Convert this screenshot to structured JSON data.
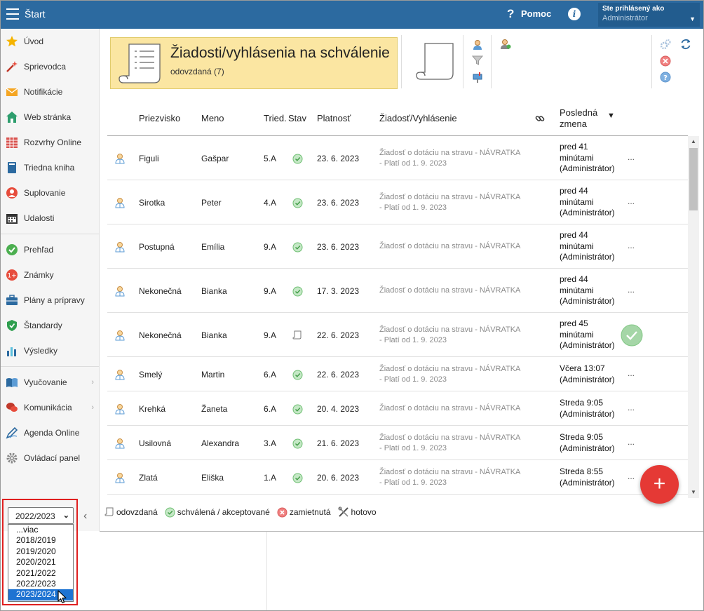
{
  "topbar": {
    "app_title": "Štart",
    "help_label": "Pomoc",
    "info_glyph": "i",
    "user_line1": "Ste prihlásený ako",
    "user_line2": "Administrátor"
  },
  "sidebar": {
    "group1": [
      {
        "label": "Úvod",
        "icon": "star-icon"
      },
      {
        "label": "Sprievodca",
        "icon": "magic-wand-icon"
      },
      {
        "label": "Notifikácie",
        "icon": "envelope-icon"
      },
      {
        "label": "Web stránka",
        "icon": "home-icon"
      },
      {
        "label": "Rozvrhy Online",
        "icon": "timetable-icon"
      },
      {
        "label": "Triedna kniha",
        "icon": "book-icon"
      },
      {
        "label": "Suplovanie",
        "icon": "substitute-icon"
      },
      {
        "label": "Udalosti",
        "icon": "calendar-icon"
      }
    ],
    "group2": [
      {
        "label": "Prehľad",
        "icon": "check-circle-icon"
      },
      {
        "label": "Známky",
        "icon": "grades-icon"
      },
      {
        "label": "Plány a prípravy",
        "icon": "briefcase-icon"
      },
      {
        "label": "Štandardy",
        "icon": "shield-icon"
      },
      {
        "label": "Výsledky",
        "icon": "bar-chart-icon"
      }
    ],
    "group3": [
      {
        "label": "Vyučovanie",
        "icon": "open-book-icon",
        "chevron": "›"
      },
      {
        "label": "Komunikácia",
        "icon": "chat-icon",
        "chevron": "›"
      },
      {
        "label": "Agenda Online",
        "icon": "pen-icon"
      },
      {
        "label": "Ovládací panel",
        "icon": "gear-icon"
      }
    ],
    "collapse_glyph": "‹"
  },
  "year_select": {
    "selected": "2022/2023",
    "options": [
      "...viac",
      "2018/2019",
      "2019/2020",
      "2020/2021",
      "2021/2022",
      "2022/2023",
      "2023/2024"
    ],
    "highlighted": "2023/2024"
  },
  "header": {
    "title": "Žiadosti/vyhlásenia na schválenie",
    "subtitle": "odovzdaná (7)"
  },
  "table": {
    "columns": {
      "surname": "Priezvisko",
      "name": "Meno",
      "class": "Tried.",
      "state": "Stav",
      "validity": "Platnosť",
      "request": "Žiadosť/Vyhlásenie",
      "last_change_1": "Posledná",
      "last_change_2": "zmena",
      "sort_glyph": "▼"
    },
    "rows": [
      {
        "surname": "Figuli",
        "name": "Gašpar",
        "class": "5.A",
        "state": "approved",
        "validity": "23. 6. 2023",
        "req1": "Žiadosť o dotáciu na stravu - NÁVRATKA",
        "req2": "- Platí od 1. 9. 2023",
        "chg1": "pred 41",
        "chg2": "minútami",
        "chg3": "(Administrátor)",
        "dots": "..."
      },
      {
        "surname": "Sirotka",
        "name": "Peter",
        "class": "4.A",
        "state": "approved",
        "validity": "23. 6. 2023",
        "req1": "Žiadosť o dotáciu na stravu - NÁVRATKA",
        "req2": "- Platí od 1. 9. 2023",
        "chg1": "pred 44",
        "chg2": "minútami",
        "chg3": "(Administrátor)",
        "dots": "..."
      },
      {
        "surname": "Postupná",
        "name": "Emília",
        "class": "9.A",
        "state": "approved",
        "validity": "23. 6. 2023",
        "req1": "Žiadosť o dotáciu na stravu - NÁVRATKA",
        "req2": "",
        "chg1": "pred 44",
        "chg2": "minútami",
        "chg3": "(Administrátor)",
        "dots": "..."
      },
      {
        "surname": "Nekonečná",
        "name": "Bianka",
        "class": "9.A",
        "state": "approved",
        "validity": "17. 3. 2023",
        "req1": "Žiadosť o dotáciu na stravu - NÁVRATKA",
        "req2": "",
        "chg1": "pred 44",
        "chg2": "minútami",
        "chg3": "(Administrátor)",
        "dots": "..."
      },
      {
        "surname": "Nekonečná",
        "name": "Bianka",
        "class": "9.A",
        "state": "submitted",
        "validity": "22. 6. 2023",
        "req1": "Žiadosť o dotáciu na stravu - NÁVRATKA",
        "req2": "- Platí od 1. 9. 2023",
        "chg1": "pred 45",
        "chg2": "minútami",
        "chg3": "(Administrátor)",
        "dots": ""
      },
      {
        "surname": "Smelý",
        "name": "Martin",
        "class": "6.A",
        "state": "approved",
        "validity": "22. 6. 2023",
        "req1": "Žiadosť o dotáciu na stravu - NÁVRATKA",
        "req2": "- Platí od 1. 9. 2023",
        "chg1": "Včera 13:07",
        "chg2": "(Administrátor)",
        "chg3": "",
        "dots": "..."
      },
      {
        "surname": "Krehká",
        "name": "Žaneta",
        "class": "6.A",
        "state": "approved",
        "validity": "20. 4. 2023",
        "req1": "Žiadosť o dotáciu na stravu - NÁVRATKA",
        "req2": "",
        "chg1": "Streda 9:05",
        "chg2": "(Administrátor)",
        "chg3": "",
        "dots": "..."
      },
      {
        "surname": "Usilovná",
        "name": "Alexandra",
        "class": "3.A",
        "state": "approved",
        "validity": "21. 6. 2023",
        "req1": "Žiadosť o dotáciu na stravu - NÁVRATKA",
        "req2": "- Platí od 1. 9. 2023",
        "chg1": "Streda 9:05",
        "chg2": "(Administrátor)",
        "chg3": "",
        "dots": "..."
      },
      {
        "surname": "Zlatá",
        "name": "Eliška",
        "class": "1.A",
        "state": "approved",
        "validity": "20. 6. 2023",
        "req1": "Žiadosť o dotáciu na stravu - NÁVRATKA",
        "req2": "- Platí od 1. 9. 2023",
        "chg1": "Streda 8:55",
        "chg2": "(Administrátor)",
        "chg3": "",
        "dots": "..."
      }
    ]
  },
  "legend": {
    "submitted": "odovzdaná",
    "approved": "schválená / akceptované",
    "rejected": "zamietnutá",
    "done": "hotovo"
  },
  "fab_label": "+",
  "colors": {
    "topbar": "#2c6aa0",
    "header_card": "#fbe6a2",
    "approved": "#4caf50",
    "fab": "#e53935",
    "selection": "#1e73d2",
    "outline": "#e02020"
  }
}
